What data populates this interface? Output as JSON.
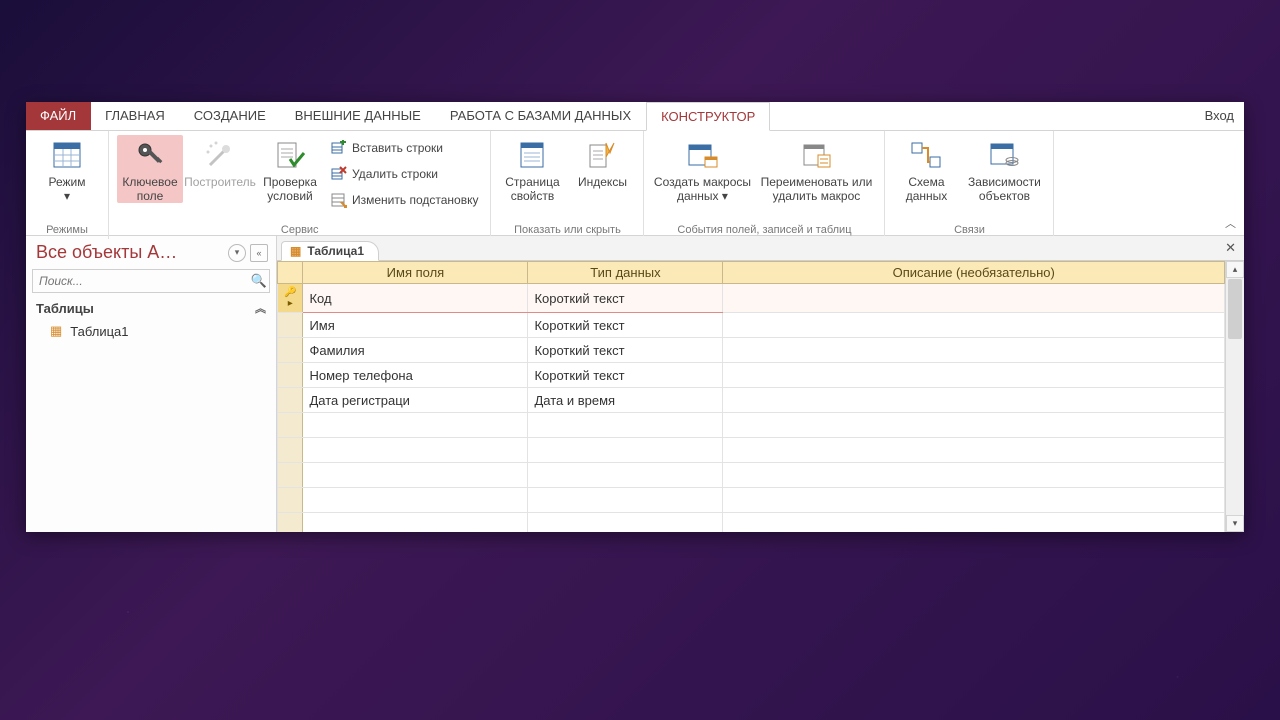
{
  "tabs": {
    "file": "ФАЙЛ",
    "items": [
      "ГЛАВНАЯ",
      "СОЗДАНИЕ",
      "ВНЕШНИЕ ДАННЫЕ",
      "РАБОТА С БАЗАМИ ДАННЫХ"
    ],
    "contextual": "КОНСТРУКТОР",
    "login": "Вход"
  },
  "ribbon": {
    "groups": {
      "views": {
        "label": "Режимы",
        "view": "Режим"
      },
      "tools": {
        "label": "Сервис",
        "primary_key": "Ключевое поле",
        "builder": "Построитель",
        "test_rules": "Проверка условий",
        "insert_rows": "Вставить строки",
        "delete_rows": "Удалить строки",
        "modify_lookup": "Изменить подстановку"
      },
      "showhide": {
        "label": "Показать или скрыть",
        "property_sheet": "Страница свойств",
        "indexes": "Индексы"
      },
      "events": {
        "label": "События полей, записей и таблиц",
        "create_macros": "Создать макросы данных",
        "rename_delete": "Переименовать или удалить макрос"
      },
      "rel": {
        "label": "Связи",
        "relationships": "Схема данных",
        "dependencies": "Зависимости объектов"
      }
    }
  },
  "nav": {
    "title": "Все объекты A…",
    "search_placeholder": "Поиск...",
    "category": "Таблицы",
    "items": [
      "Таблица1"
    ]
  },
  "doc": {
    "tab": "Таблица1"
  },
  "grid": {
    "headers": {
      "field_name": "Имя поля",
      "data_type": "Тип данных",
      "description": "Описание (необязательно)"
    },
    "rows": [
      {
        "name": "Код",
        "type": "Короткий текст",
        "key": true,
        "current": true
      },
      {
        "name": "Имя",
        "type": "Короткий текст"
      },
      {
        "name": "Фамилия",
        "type": "Короткий текст"
      },
      {
        "name": "Номер телефона",
        "type": "Короткий текст"
      },
      {
        "name": "Дата регистраци",
        "type": "Дата и время"
      }
    ],
    "blank_rows": 6
  }
}
